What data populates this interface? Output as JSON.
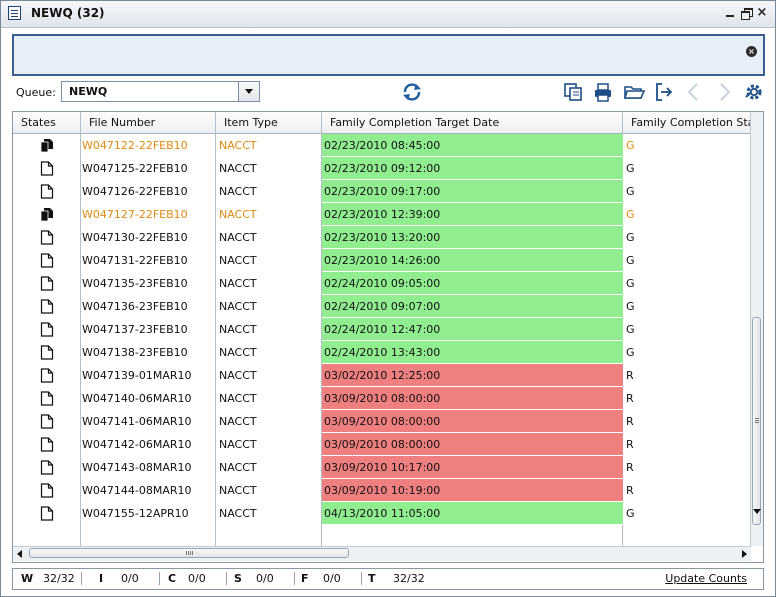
{
  "window": {
    "title": "NEWQ (32)"
  },
  "queue": {
    "label": "Queue:",
    "value": "NEWQ"
  },
  "columns": [
    "States",
    "File Number",
    "Item Type",
    "Family Completion Target Date",
    "Family Completion State"
  ],
  "rows": [
    {
      "state": "checked-out",
      "file": "W047122-22FEB10",
      "type": "NACCT",
      "date": "02/23/2010 08:45:00",
      "status": "G",
      "color": "green",
      "highlight": true
    },
    {
      "state": "document",
      "file": "W047125-22FEB10",
      "type": "NACCT",
      "date": "02/23/2010 09:12:00",
      "status": "G",
      "color": "green",
      "highlight": false
    },
    {
      "state": "document",
      "file": "W047126-22FEB10",
      "type": "NACCT",
      "date": "02/23/2010 09:17:00",
      "status": "G",
      "color": "green",
      "highlight": false
    },
    {
      "state": "checked-out",
      "file": "W047127-22FEB10",
      "type": "NACCT",
      "date": "02/23/2010 12:39:00",
      "status": "G",
      "color": "green",
      "highlight": true
    },
    {
      "state": "document",
      "file": "W047130-22FEB10",
      "type": "NACCT",
      "date": "02/23/2010 13:20:00",
      "status": "G",
      "color": "green",
      "highlight": false
    },
    {
      "state": "document",
      "file": "W047131-22FEB10",
      "type": "NACCT",
      "date": "02/23/2010 14:26:00",
      "status": "G",
      "color": "green",
      "highlight": false
    },
    {
      "state": "document",
      "file": "W047135-23FEB10",
      "type": "NACCT",
      "date": "02/24/2010 09:05:00",
      "status": "G",
      "color": "green",
      "highlight": false
    },
    {
      "state": "document",
      "file": "W047136-23FEB10",
      "type": "NACCT",
      "date": "02/24/2010 09:07:00",
      "status": "G",
      "color": "green",
      "highlight": false
    },
    {
      "state": "document",
      "file": "W047137-23FEB10",
      "type": "NACCT",
      "date": "02/24/2010 12:47:00",
      "status": "G",
      "color": "green",
      "highlight": false
    },
    {
      "state": "document",
      "file": "W047138-23FEB10",
      "type": "NACCT",
      "date": "02/24/2010 13:43:00",
      "status": "G",
      "color": "green",
      "highlight": false
    },
    {
      "state": "document",
      "file": "W047139-01MAR10",
      "type": "NACCT",
      "date": "03/02/2010 12:25:00",
      "status": "R",
      "color": "red",
      "highlight": false
    },
    {
      "state": "document",
      "file": "W047140-06MAR10",
      "type": "NACCT",
      "date": "03/09/2010 08:00:00",
      "status": "R",
      "color": "red",
      "highlight": false
    },
    {
      "state": "document",
      "file": "W047141-06MAR10",
      "type": "NACCT",
      "date": "03/09/2010 08:00:00",
      "status": "R",
      "color": "red",
      "highlight": false
    },
    {
      "state": "document",
      "file": "W047142-06MAR10",
      "type": "NACCT",
      "date": "03/09/2010 08:00:00",
      "status": "R",
      "color": "red",
      "highlight": false
    },
    {
      "state": "document",
      "file": "W047143-08MAR10",
      "type": "NACCT",
      "date": "03/09/2010 10:17:00",
      "status": "R",
      "color": "red",
      "highlight": false
    },
    {
      "state": "document",
      "file": "W047144-08MAR10",
      "type": "NACCT",
      "date": "03/09/2010 10:19:00",
      "status": "R",
      "color": "red",
      "highlight": false
    },
    {
      "state": "document",
      "file": "W047155-12APR10",
      "type": "NACCT",
      "date": "04/13/2010 11:05:00",
      "status": "G",
      "color": "green",
      "highlight": false
    }
  ],
  "status": {
    "items": [
      {
        "key": "W",
        "value": "32/32"
      },
      {
        "key": "I",
        "value": "0/0"
      },
      {
        "key": "C",
        "value": "0/0"
      },
      {
        "key": "S",
        "value": "0/0"
      },
      {
        "key": "F",
        "value": "0/0"
      },
      {
        "key": "T",
        "value": "32/32"
      }
    ],
    "update_label": "Update Counts"
  },
  "colors": {
    "green": "#90ee90",
    "red": "#f08080",
    "highlight": "#e08a12"
  },
  "toolbar_icons": [
    "refresh-icon",
    "copy-icon",
    "print-icon",
    "open-folder-icon",
    "exit-icon",
    "prev-arrow-icon",
    "next-arrow-icon",
    "settings-icon"
  ]
}
